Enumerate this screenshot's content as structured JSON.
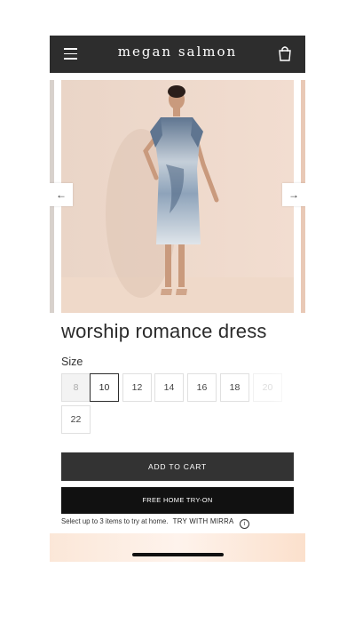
{
  "header": {
    "brand": "megan salmon",
    "menu_icon": "hamburger-menu-icon",
    "bag_icon": "shopping-bag-icon"
  },
  "carousel": {
    "prev_arrow": "←",
    "next_arrow": "→"
  },
  "product": {
    "title": "worship romance dress"
  },
  "size": {
    "label": "Size",
    "options": [
      "8",
      "10",
      "12",
      "14",
      "16",
      "18",
      "20",
      "22"
    ],
    "selected": "10",
    "unavailable": [
      "8"
    ]
  },
  "actions": {
    "add_to_cart": "ADD TO CART",
    "free_home_tryon": "FREE HOME TRY-ON",
    "tryon_note": "Select up to 3 items to try at home.",
    "try_with": "TRY WITH MIRRA",
    "info_glyph": "i"
  },
  "colors": {
    "header_bg": "#2d2d2d",
    "cart_bg": "#333333",
    "tryon_bg": "#111111"
  }
}
